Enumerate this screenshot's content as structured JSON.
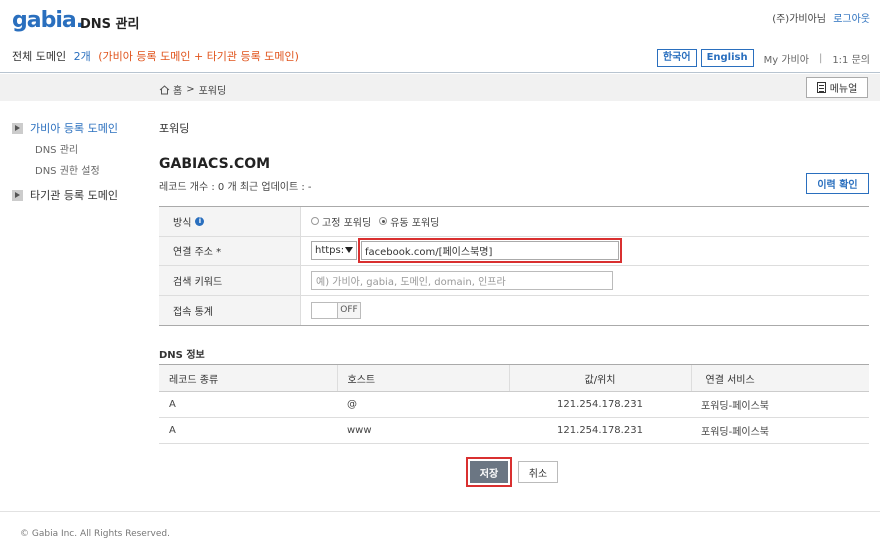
{
  "header": {
    "logo": "gabia.",
    "app_title": "DNS 관리",
    "user_name": "(주)가비아님",
    "logout": "로그아웃",
    "domain_total_label": "전체 도메인",
    "domain_total_count": "2개",
    "domain_total_detail": "(가비아 등록 도메인 + 타기관 등록 도메인)",
    "lang_korean": "한국어",
    "lang_english": "English",
    "my_gabia": "My 가비아",
    "separator": "|",
    "inquiry": "1:1 문의"
  },
  "breadcrumb": {
    "home": "홈",
    "sep": ">",
    "current": "포워딩"
  },
  "menu_button": "메뉴얼",
  "sidebar": {
    "group1": "가비아 등록 도메인",
    "sub1": "DNS 관리",
    "sub2": "DNS 권한 설정",
    "group2": "타기관 등록 도메인"
  },
  "main": {
    "section_label": "포워딩",
    "domain": "GABIACS.COM",
    "record_info": "레코드 개수 : 0 개   최근 업데이트 : -",
    "history_button": "이력 확인"
  },
  "form": {
    "method_label": "방식",
    "method_option1": "고정 포워딩",
    "method_option2": "유동 포워딩",
    "method_selected": "유동 포워딩",
    "address_label": "연결 주소 *",
    "protocol": "https:",
    "address_value": "facebook.com/[페이스북명]",
    "keyword_label": "검색 키워드",
    "keyword_placeholder": "예) 가비아, gabia, 도메인, domain, 인프라",
    "stats_label": "접속 통계",
    "stats_state": "OFF"
  },
  "dns": {
    "title": "DNS 정보",
    "columns": [
      "레코드 종류",
      "호스트",
      "값/위치",
      "연결 서비스"
    ],
    "rows": [
      [
        "A",
        "@",
        "121.254.178.231",
        "포워딩-페이스북"
      ],
      [
        "A",
        "www",
        "121.254.178.231",
        "포워딩-페이스북"
      ]
    ]
  },
  "buttons": {
    "save": "저장",
    "cancel": "취소"
  },
  "footer": "© Gabia Inc. All Rights Reserved.",
  "colors": {
    "brand": "#2a6fbe",
    "accent_orange": "#e0541c",
    "highlight": "#d93030"
  }
}
